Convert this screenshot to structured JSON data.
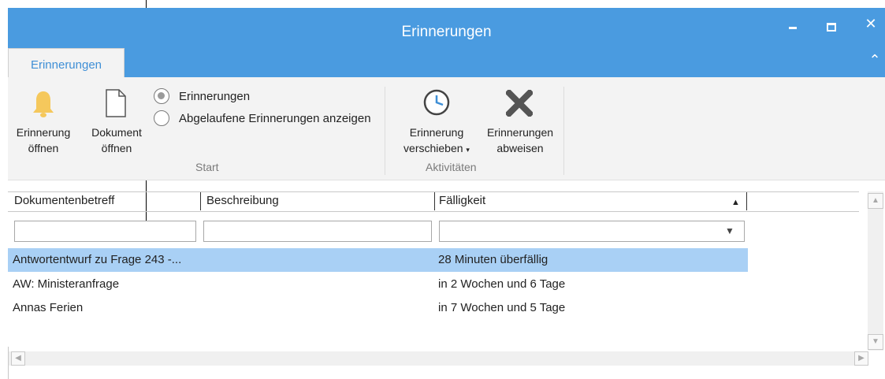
{
  "window": {
    "title": "Erinnerungen",
    "minimize_icon": "minimize-icon",
    "maximize_icon": "maximize-icon",
    "close_icon": "close-icon"
  },
  "ribbon": {
    "tab_label": "Erinnerungen",
    "buttons": {
      "open_reminder": [
        "Erinnerung",
        "öffnen"
      ],
      "open_document": [
        "Dokument",
        "öffnen"
      ],
      "postpone_reminder": [
        "Erinnerung",
        "verschieben"
      ],
      "dismiss_reminders": [
        "Erinnerungen",
        "abweisen"
      ]
    },
    "radios": [
      {
        "label": "Erinnerungen",
        "selected": true
      },
      {
        "label": "Abgelaufene Erinnerungen anzeigen",
        "selected": false
      }
    ],
    "groups": {
      "start": "Start",
      "activities": "Aktivitäten"
    }
  },
  "grid": {
    "columns": [
      "Dokumentenbetreff",
      "Beschreibung",
      "Fälligkeit"
    ],
    "sort_indicator": "▲",
    "filters": [
      "",
      "",
      ""
    ],
    "rows": [
      {
        "subject": "Antwortentwurf zu Frage 243 -...",
        "due": "28 Minuten überfällig",
        "selected": true
      },
      {
        "subject": "AW: Ministeranfrage",
        "due": "in 2 Wochen und 6 Tage",
        "selected": false
      },
      {
        "subject": "Annas Ferien",
        "due": "in 7 Wochen und 5 Tage",
        "selected": false
      }
    ]
  },
  "colors": {
    "titlebar": "#4a9be0",
    "selection": "#a9d0f5",
    "bell": "#f5c85c"
  }
}
